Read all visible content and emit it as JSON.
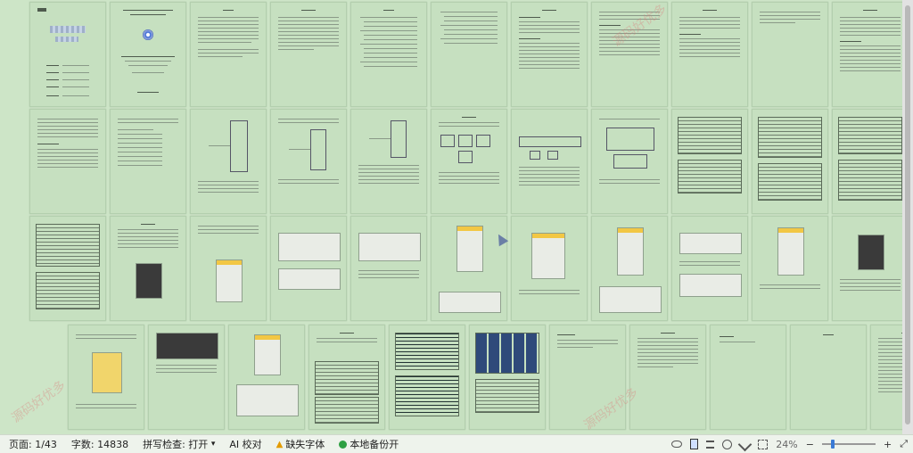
{
  "status_bar": {
    "page": "页面: 1/43",
    "words": "字数: 14838",
    "spell": "拼写检查: 打开",
    "spell_arrow": "▾",
    "ai": "AI 校对",
    "missing_font": "缺失字体",
    "backup": "本地备份开",
    "zoom": "24%",
    "zoom_out": "−",
    "zoom_in": "+",
    "expand": "⤢"
  },
  "watermark": "源码好优多",
  "icons": [
    "eye-icon",
    "page-view-icon",
    "outline-icon",
    "web-icon",
    "pen-icon",
    "fit-icon"
  ]
}
